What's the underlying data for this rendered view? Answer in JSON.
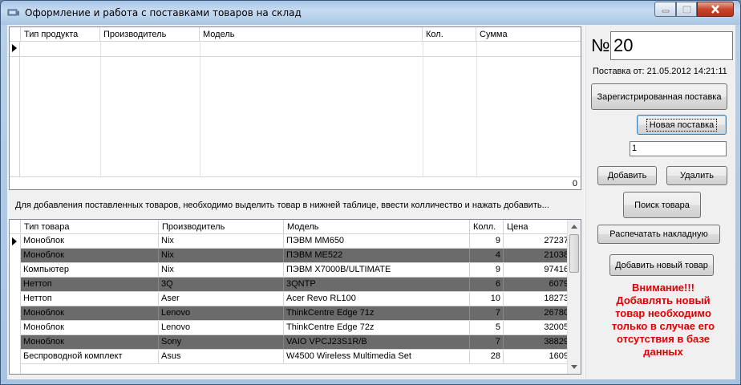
{
  "window": {
    "title": "Оформление и работа с поставками товаров на склад"
  },
  "upper_grid": {
    "columns": [
      "Тип продукта",
      "Производитель",
      "Модель",
      "Кол.",
      "Сумма"
    ],
    "total": "0"
  },
  "hint": "Для добавления поставленных товаров, необходимо выделить товар в нижней таблице, ввести колличество и нажать добавить...",
  "lower_grid": {
    "columns": [
      "Тип товара",
      "Производитель",
      "Модель",
      "Колл.",
      "Цена"
    ],
    "rows": [
      [
        "Моноблок",
        "Nix",
        "ПЭВМ MM650",
        "9",
        "27237"
      ],
      [
        "Моноблок",
        "Nix",
        "ПЭВМ ME522",
        "4",
        "21038"
      ],
      [
        "Компьютер",
        "Nix",
        "ПЭВМ X7000B/ULTIMATE",
        "9",
        "97416"
      ],
      [
        "Неттоп",
        "3Q",
        "3QNTP",
        "6",
        "6079"
      ],
      [
        "Неттоп",
        "Aser",
        "Acer Revo RL100",
        "10",
        "18273"
      ],
      [
        "Моноблок",
        "Lenovo",
        "ThinkCentre Edge 71z",
        "7",
        "26780"
      ],
      [
        "Моноблок",
        "Lenovo",
        "ThinkCentre Edge 72z",
        "5",
        "32005"
      ],
      [
        "Моноблок",
        "Sony",
        "VAIO VPCJ23S1R/B",
        "7",
        "38829"
      ],
      [
        "Беспроводной комплект",
        "Asus",
        "W4500 Wireless Multimedia Set",
        "28",
        "1609"
      ]
    ]
  },
  "panel": {
    "number_sign": "№",
    "number_value": "20",
    "date_label": "Поставка от: 21.05.2012 14:21:11",
    "registered_button": "Зарегистрированная поставка",
    "new_button": "Новая поставка",
    "quantity_value": "1",
    "add_button": "Добавить",
    "delete_button": "Удалить",
    "search_button": "Поиск товара",
    "print_button": "Распечатать накладную",
    "add_new_product_button": "Добавить новый товар",
    "warning": "Внимание!!! Добавлять новый товар необходимо только в случае его отсутствия в базе данных"
  }
}
